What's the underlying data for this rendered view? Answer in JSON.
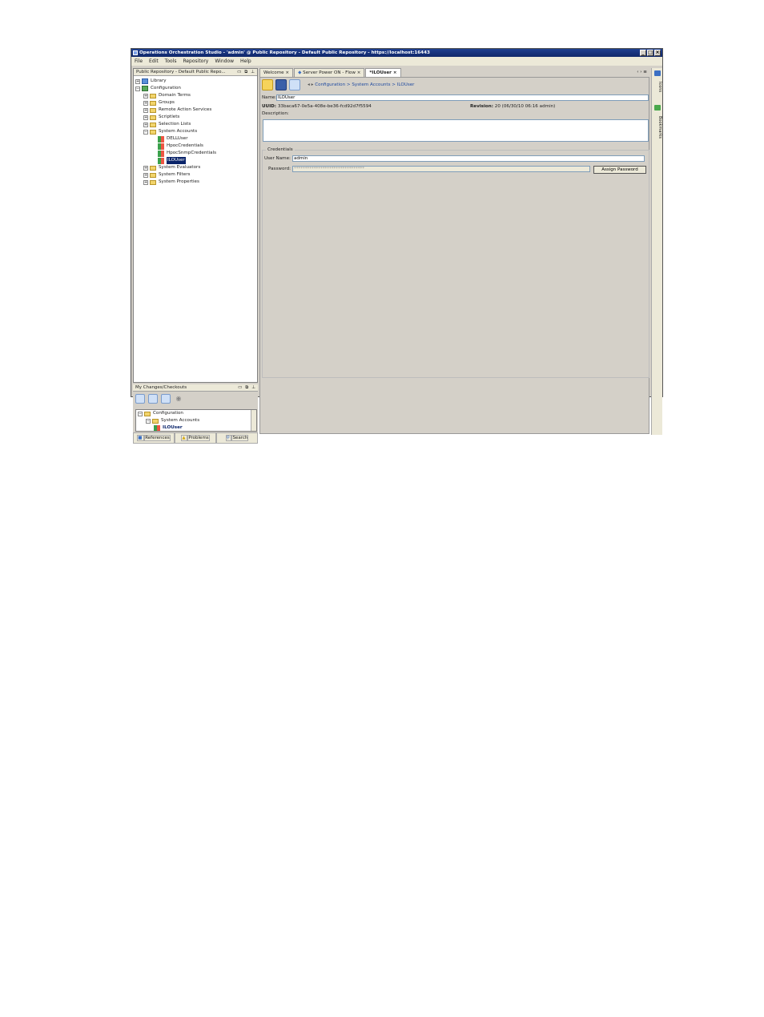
{
  "window": {
    "title": "Operations Orchestration Studio - 'admin' @ Public Repository - Default Public Repository - https://localhost:16443"
  },
  "menu": [
    "File",
    "Edit",
    "Tools",
    "Repository",
    "Window",
    "Help"
  ],
  "repository_panel": {
    "title": "Public Repository - Default Public Repo..."
  },
  "tree": {
    "library": "Library",
    "configuration": "Configuration",
    "items": [
      "Domain Terms",
      "Groups",
      "Remote Action Services",
      "Scriptlets",
      "Selection Lists",
      "System Accounts"
    ],
    "accounts": [
      "DELLUser",
      "HpocCredentials",
      "HpocSnmpCredentials",
      "ILOUser"
    ],
    "tail": [
      "System Evaluators",
      "System Filters",
      "System Properties"
    ]
  },
  "changes_panel": {
    "title": "My Changes/Checkouts",
    "tree": [
      "Configuration",
      "System Accounts",
      "ILOUser"
    ]
  },
  "bottom_tabs": [
    "References",
    "Problems",
    "Search"
  ],
  "editor_tabs": [
    "Welcome",
    "Server Power ON - Flow",
    "*ILOUser"
  ],
  "breadcrumb": [
    "Configuration",
    "System Accounts",
    "ILOUser"
  ],
  "form": {
    "name_label": "Name:",
    "name_value": "ILOUser",
    "uuid_label": "UUID:",
    "uuid_value": "33baca67-0e5a-408e-be36-fcd92d7f5594",
    "revision_label": "Revision:",
    "revision_value": "20 (06/30/10 06:16 admin)",
    "description_label": "Description:"
  },
  "credentials": {
    "legend": "Credentials",
    "username_label": "User Name:",
    "username_value": "admin",
    "password_label": "Password:",
    "password_value": "********************************",
    "assign_button": "Assign Password"
  },
  "right_tabs": [
    "Icons",
    "Bookmarks"
  ]
}
